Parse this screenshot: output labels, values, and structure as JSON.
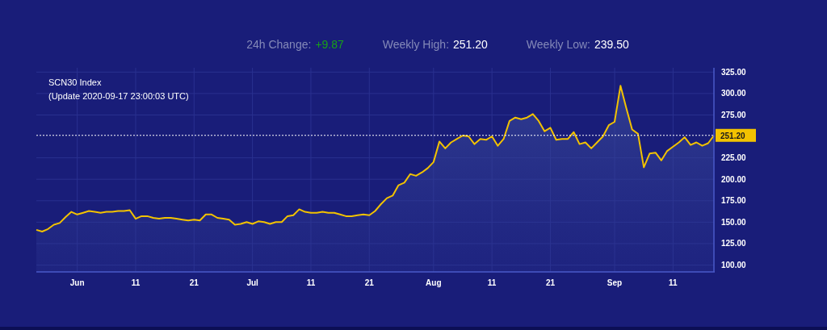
{
  "stats": [
    {
      "label": "24h Change:",
      "value": "+9.87",
      "color": "#18a018"
    },
    {
      "label": "Weekly High:",
      "value": "251.20",
      "color": "#ffffff"
    },
    {
      "label": "Weekly Low:",
      "value": "239.50",
      "color": "#ffffff"
    }
  ],
  "chart": {
    "update_note": "(Update 2020-09-17 23:00:03 UTC)",
    "chart_data": {
      "type": "area",
      "title": "SCN30 Index",
      "grid": true,
      "categories": [
        null,
        null,
        null,
        null,
        null,
        null,
        null,
        "Jun",
        null,
        null,
        null,
        null,
        null,
        null,
        null,
        null,
        null,
        "11",
        null,
        null,
        null,
        null,
        null,
        null,
        null,
        null,
        null,
        "21",
        null,
        null,
        null,
        null,
        null,
        null,
        null,
        null,
        null,
        "Jul",
        null,
        null,
        null,
        null,
        null,
        null,
        null,
        null,
        null,
        "11",
        null,
        null,
        null,
        null,
        null,
        null,
        null,
        null,
        null,
        "21",
        null,
        null,
        null,
        null,
        null,
        null,
        null,
        null,
        null,
        null,
        "Aug",
        null,
        null,
        null,
        null,
        null,
        null,
        null,
        null,
        null,
        "11",
        null,
        null,
        null,
        null,
        null,
        null,
        null,
        null,
        null,
        "21",
        null,
        null,
        null,
        null,
        null,
        null,
        null,
        null,
        null,
        null,
        "Sep",
        null,
        null,
        null,
        null,
        null,
        null,
        null,
        null,
        null,
        "11",
        null,
        null,
        null,
        null,
        null,
        null,
        null
      ],
      "series": [
        {
          "color": "#f2c200",
          "values": [
            141,
            139,
            142,
            147,
            149,
            156,
            162,
            159,
            161,
            163,
            162,
            161,
            162,
            162,
            163,
            163,
            164,
            154,
            157,
            157,
            155,
            154,
            155,
            155,
            154,
            153,
            152,
            153,
            152,
            159,
            159,
            155,
            154,
            153,
            147,
            148,
            150,
            148,
            151,
            150,
            148,
            150,
            150,
            157,
            158,
            165,
            162,
            161,
            161,
            162,
            161,
            161,
            159,
            157,
            157,
            158,
            159,
            158,
            163,
            171,
            178,
            181,
            193,
            196,
            206,
            204,
            208,
            213,
            220,
            244,
            236,
            243,
            247,
            251,
            250,
            241,
            247,
            246,
            250,
            239,
            247,
            268,
            272,
            270,
            272,
            276,
            268,
            256,
            260,
            246,
            247,
            247,
            255,
            241,
            243,
            236,
            243,
            250,
            263,
            267,
            309,
            283,
            258,
            253,
            214,
            230,
            231,
            222,
            233,
            238,
            243,
            249,
            240,
            243,
            239,
            242,
            251
          ]
        }
      ],
      "ylim": [
        92,
        330
      ],
      "yticks": [
        {
          "value": 100,
          "label": "100.00"
        },
        {
          "value": 125,
          "label": "125.00"
        },
        {
          "value": 150,
          "label": "150.00"
        },
        {
          "value": 175,
          "label": "175.00"
        },
        {
          "value": 200,
          "label": "200.00"
        },
        {
          "value": 225,
          "label": "225.00"
        },
        {
          "value": 275,
          "label": "275.00"
        },
        {
          "value": 300,
          "label": "300.00"
        },
        {
          "value": 325,
          "label": "325.00"
        }
      ],
      "ref_lines": [
        {
          "axis": "y",
          "value": 251.2,
          "label": "251.20"
        }
      ]
    }
  }
}
